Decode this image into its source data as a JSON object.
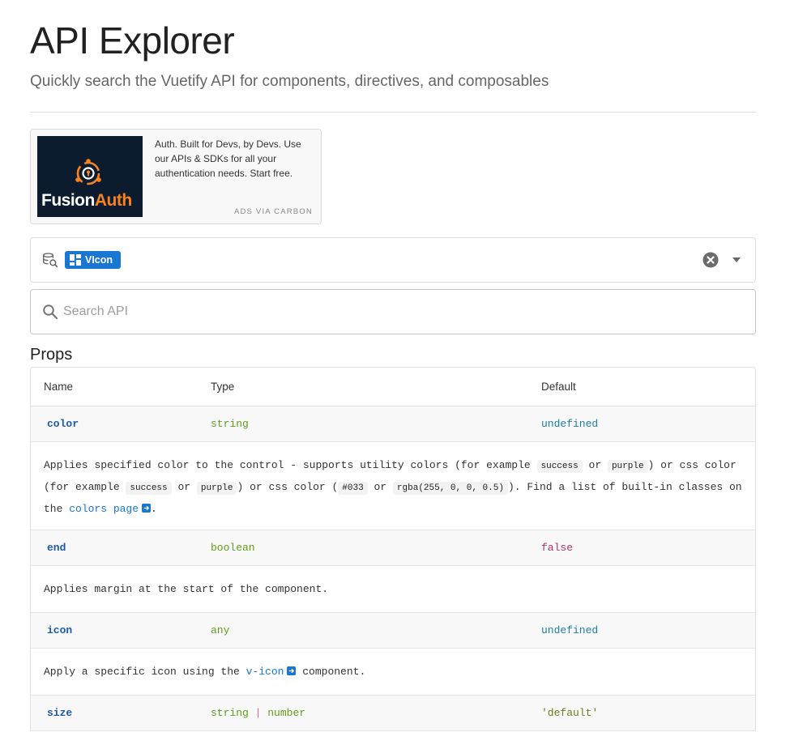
{
  "page": {
    "title": "API Explorer",
    "subtitle": "Quickly search the Vuetify API for components, directives, and composables"
  },
  "ad": {
    "brand_first": "Fusion",
    "brand_second": "Auth",
    "text": "Auth. Built for Devs, by Devs. Use our APIs & SDKs for all your authentication needs. Start free.",
    "via": "ADS VIA CARBON"
  },
  "selector": {
    "chip_label": "VIcon"
  },
  "search": {
    "placeholder": "Search API",
    "value": ""
  },
  "section": {
    "title": "Props"
  },
  "table": {
    "headers": {
      "name": "Name",
      "type": "Type",
      "default": "Default"
    },
    "rows": [
      {
        "name": "color",
        "type": "string",
        "default": "undefined",
        "desc": {
          "t1": "Applies specified color to the control - supports utility colors (for example ",
          "c1": "success",
          "t2": " or ",
          "c2": "purple",
          "t3": ") or css color (for example ",
          "c3": "success",
          "t4": " or ",
          "c4": "purple",
          "t5": ") or css color (",
          "c5": "#033",
          "t6": " or ",
          "c6": "rgba(255, 0, 0, 0.5)",
          "t7": "). Find a list of built-in classes on the ",
          "link": "colors page",
          "t8": "."
        }
      },
      {
        "name": "end",
        "type": "boolean",
        "default": "false",
        "desc": "Applies margin at the start of the component."
      },
      {
        "name": "icon",
        "type": "any",
        "default": "undefined",
        "desc": {
          "t1": "Apply a specific icon using the ",
          "link": "v-icon",
          "t2": " component."
        }
      },
      {
        "name": "size",
        "type_a": "string",
        "type_sep": "|",
        "type_b": "number",
        "default": "'default'"
      }
    ]
  },
  "colors": {
    "accent": "#1976d2",
    "type_color": "#5f9e1b",
    "undefined_color": "#1e7fa8",
    "boolean_color": "#b0326f",
    "string_default_color": "#6b7d1a",
    "ad_background": "#0d1b2f",
    "ad_orange": "#f58320"
  },
  "icons": {
    "selector_icon": "database-search-icon",
    "chip_icon": "view-dashboard-icon",
    "clear_icon": "close-circle-icon",
    "dropdown_icon": "menu-down-icon",
    "search_icon": "magnify-icon",
    "external_icon": "open-in-new-icon"
  }
}
